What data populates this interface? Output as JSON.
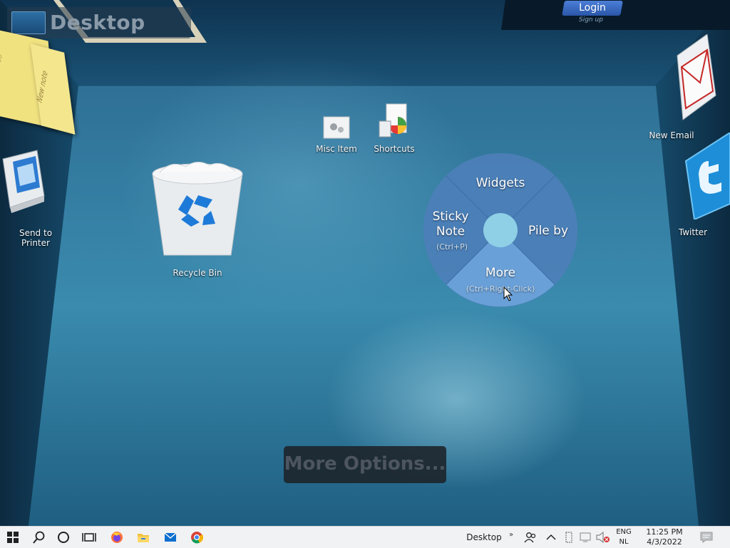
{
  "desktop": {
    "title": "Desktop",
    "login_label": "Login",
    "signup_label": "Sign up",
    "sticky_note_texts": [
      "New note",
      "to-do"
    ],
    "icons": {
      "misc": "Misc Item",
      "shortcuts": "Shortcuts",
      "recycle": "Recycle Bin"
    },
    "side": {
      "printer": "Send to Printer",
      "email": "New Email",
      "twitter": "Twitter"
    },
    "radial_menu": {
      "top": "Widgets",
      "left": "Sticky Note",
      "left_hint": "(Ctrl+P)",
      "right": "Pile by",
      "bottom": "More",
      "bottom_hint": "(Ctrl+Right-Click)"
    },
    "more_options": "More Options..."
  },
  "taskbar": {
    "desktop_label": "Desktop",
    "chevron": "»",
    "lang_line1": "ENG",
    "lang_line2": "NL",
    "time": "11:25 PM",
    "date": "4/3/2022",
    "icons": [
      "windows-start-icon",
      "search-icon",
      "cortana-icon",
      "task-view-icon",
      "firefox-icon",
      "file-explorer-icon",
      "mail-icon",
      "chrome-icon"
    ]
  }
}
